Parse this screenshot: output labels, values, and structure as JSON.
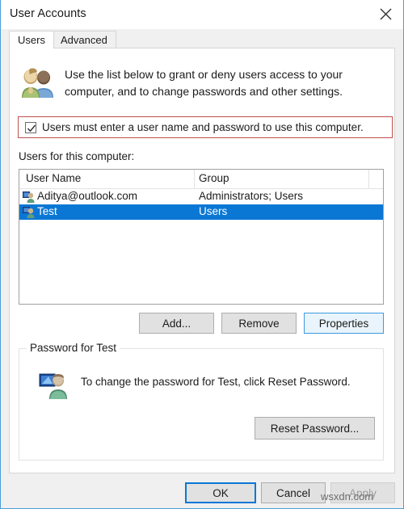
{
  "window": {
    "title": "User Accounts",
    "close_icon": "close-icon",
    "border_color": "#4b9ed6"
  },
  "tabs": [
    {
      "label": "Users",
      "active": true
    },
    {
      "label": "Advanced",
      "active": false
    }
  ],
  "intro": {
    "icon": "two-users-icon",
    "text": "Use the list below to grant or deny users access to your computer, and to change passwords and other settings."
  },
  "require_password_checkbox": {
    "label": "Users must enter a user name and password to use this computer.",
    "checked": true,
    "highlight_color": "#c0504d"
  },
  "user_list": {
    "label": "Users for this computer:",
    "columns": [
      "User Name",
      "Group"
    ],
    "rows": [
      {
        "icon": "user-account-icon",
        "name": "Aditya@outlook.com",
        "group": "Administrators; Users",
        "selected": false
      },
      {
        "icon": "user-account-icon",
        "name": "Test",
        "group": "Users",
        "selected": true
      }
    ],
    "selection_color": "#0b77d4"
  },
  "list_actions": {
    "add_label": "Add...",
    "remove_label": "Remove",
    "properties_label": "Properties",
    "properties_focused": true
  },
  "password_group": {
    "title": "Password for Test",
    "icon": "user-monitor-icon",
    "text": "To change the password for Test, click Reset Password.",
    "reset_label": "Reset Password..."
  },
  "footer": {
    "ok_label": "OK",
    "cancel_label": "Cancel",
    "apply_label": "Apply",
    "apply_disabled": true,
    "ok_is_default": true
  },
  "watermark": "wsxdn.com"
}
